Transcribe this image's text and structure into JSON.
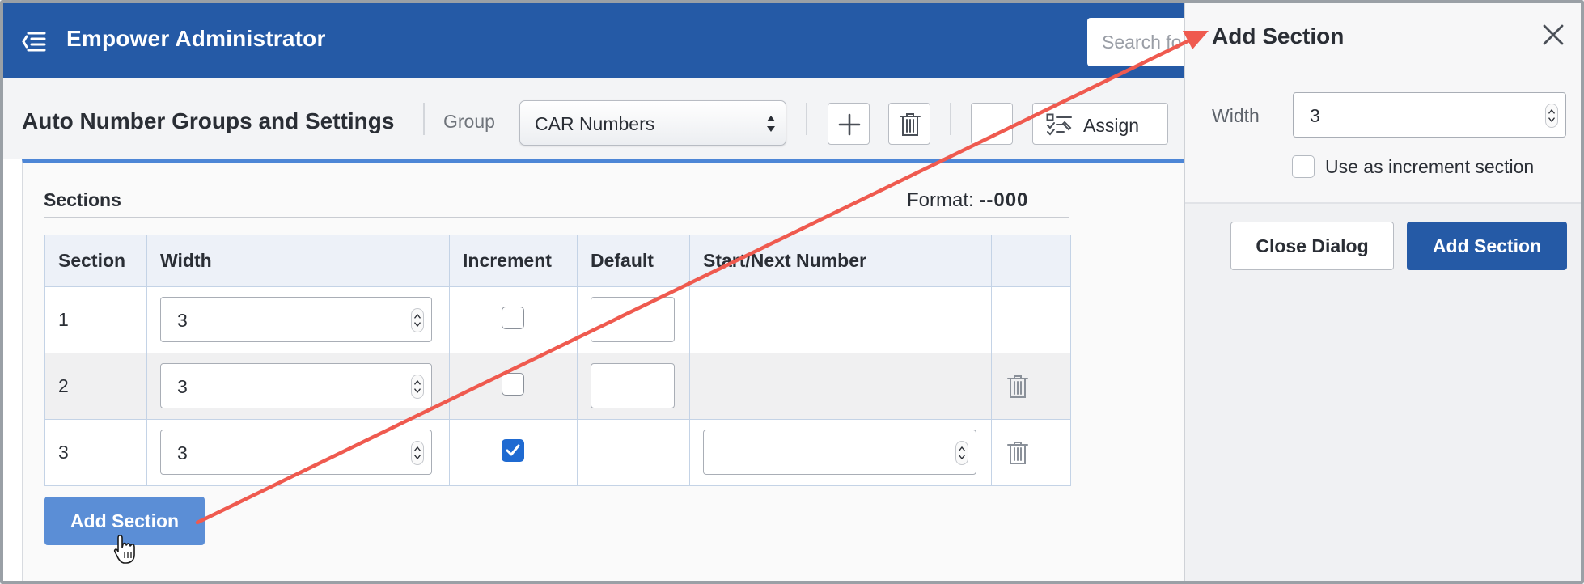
{
  "header": {
    "app_title": "Empower Administrator",
    "search_placeholder": "Search fo"
  },
  "toolbar": {
    "page_title": "Auto Number Groups and Settings",
    "group_label": "Group",
    "group_selected": "CAR Numbers",
    "add_icon": "plus-icon",
    "delete_icon": "trash-icon",
    "assign_icon": "checklist-icon",
    "assign_label": "Assign"
  },
  "sections": {
    "title": "Sections",
    "format_label": "Format:",
    "format_value": "--000",
    "columns": [
      "Section",
      "Width",
      "Increment",
      "Default",
      "Start/Next Number"
    ],
    "rows": [
      {
        "section": "1",
        "width": "3",
        "increment": false,
        "has_default": true,
        "has_start": false,
        "deletable": false
      },
      {
        "section": "2",
        "width": "3",
        "increment": false,
        "has_default": true,
        "has_start": false,
        "deletable": true
      },
      {
        "section": "3",
        "width": "3",
        "increment": true,
        "has_default": false,
        "has_start": true,
        "deletable": true
      }
    ],
    "add_button": "Add Section"
  },
  "dialog": {
    "title": "Add Section",
    "close_icon": "close-icon",
    "width_label": "Width",
    "width_value": "3",
    "increment_checkbox_label": "Use as increment section",
    "increment_checked": false,
    "close_button": "Close Dialog",
    "add_button": "Add Section"
  },
  "colors": {
    "header_bg": "#255aa6",
    "primary_button": "#255aa6",
    "add_section_button": "#5b8ed6",
    "checkbox_checked": "#1f6ad1",
    "annotation_arrow": "#ef5a4f"
  }
}
